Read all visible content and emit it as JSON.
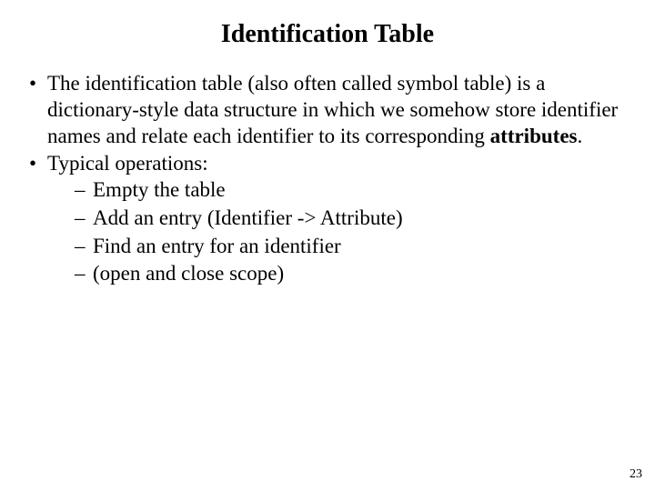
{
  "title": "Identification Table",
  "bullets": [
    {
      "pre": "The identification table (also often called symbol table) is a dictionary-style data structure in which we somehow store identifier names and relate each identifier to its corresponding ",
      "bold": "attributes",
      "post": "."
    },
    {
      "pre": "Typical operations:",
      "bold": "",
      "post": ""
    }
  ],
  "sub": [
    "Empty the table",
    "Add an entry (Identifier -> Attribute)",
    "Find an entry for an identifier",
    "(open and close scope)"
  ],
  "page_number": "23"
}
